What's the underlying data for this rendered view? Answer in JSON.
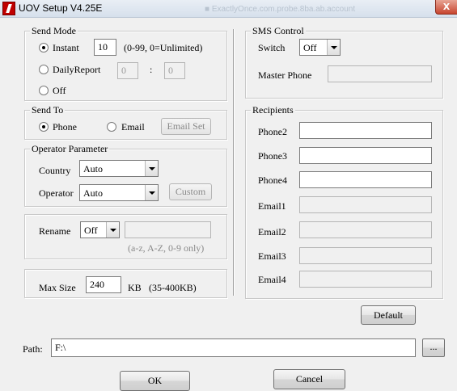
{
  "window": {
    "title": "UOV Setup V4.25E",
    "behind_text": "■ ExactlyOnce.com.probe.8ba.ab.account",
    "close_glyph": "X"
  },
  "send_mode": {
    "legend": "Send Mode",
    "instant_label": "Instant",
    "instant_value": "10",
    "instant_hint": "(0-99, 0=Unlimited)",
    "daily_label": "DailyReport",
    "daily_hour": "0",
    "daily_sep": ":",
    "daily_min": "0",
    "off_label": "Off",
    "selected": "Instant"
  },
  "send_to": {
    "legend": "Send To",
    "phone_label": "Phone",
    "email_label": "Email",
    "email_set_label": "Email Set",
    "selected": "Phone"
  },
  "operator": {
    "legend": "Operator Parameter",
    "country_label": "Country",
    "country_value": "Auto",
    "operator_label": "Operator",
    "operator_value": "Auto",
    "custom_label": "Custom"
  },
  "rename": {
    "label": "Rename",
    "value": "Off",
    "text": "",
    "hint": "(a-z, A-Z, 0-9 only)"
  },
  "maxsize": {
    "label": "Max Size",
    "value": "240",
    "unit": "KB",
    "hint": "(35-400KB)"
  },
  "sms": {
    "legend": "SMS Control",
    "switch_label": "Switch",
    "switch_value": "Off",
    "master_label": "Master Phone",
    "master_value": ""
  },
  "recipients": {
    "legend": "Recipients",
    "items": [
      {
        "label": "Phone2",
        "value": ""
      },
      {
        "label": "Phone3",
        "value": ""
      },
      {
        "label": "Phone4",
        "value": ""
      },
      {
        "label": "Email1",
        "value": ""
      },
      {
        "label": "Email2",
        "value": ""
      },
      {
        "label": "Email3",
        "value": ""
      },
      {
        "label": "Email4",
        "value": ""
      }
    ]
  },
  "default_label": "Default",
  "path": {
    "label": "Path:",
    "value": "F:\\",
    "browse_label": "..."
  },
  "ok_label": "OK",
  "cancel_label": "Cancel"
}
